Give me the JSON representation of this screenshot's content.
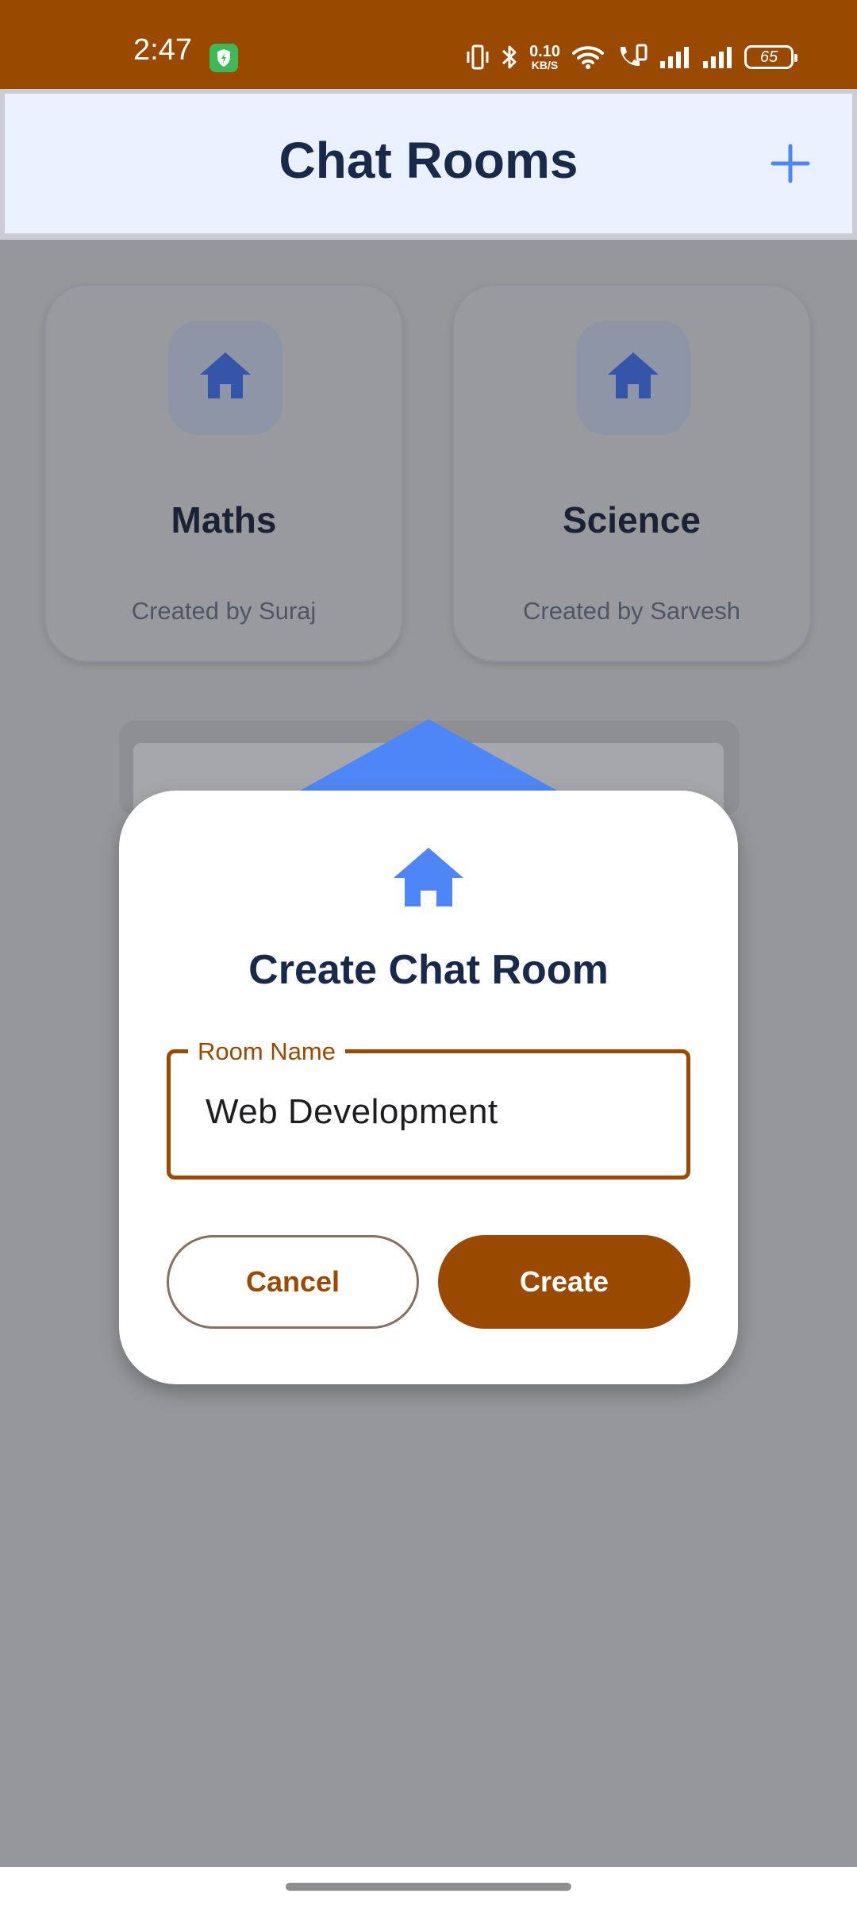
{
  "status_bar": {
    "time": "2:47",
    "net_speed_value": "0.10",
    "net_speed_unit": "KB/S",
    "battery": "65"
  },
  "header": {
    "title": "Chat Rooms",
    "add_icon": "plus-icon"
  },
  "rooms": [
    {
      "name": "Maths",
      "creator": "Created by Suraj",
      "icon": "home-icon"
    },
    {
      "name": "Science",
      "creator": "Created by Sarvesh",
      "icon": "home-icon"
    }
  ],
  "dialog": {
    "icon": "home-icon",
    "title": "Create Chat Room",
    "field_label": "Room Name",
    "field_value": "Web Development",
    "cancel_label": "Cancel",
    "create_label": "Create"
  },
  "colors": {
    "accent": "#9A4A00",
    "blue": "#4F86F7",
    "title": "#19294A"
  }
}
